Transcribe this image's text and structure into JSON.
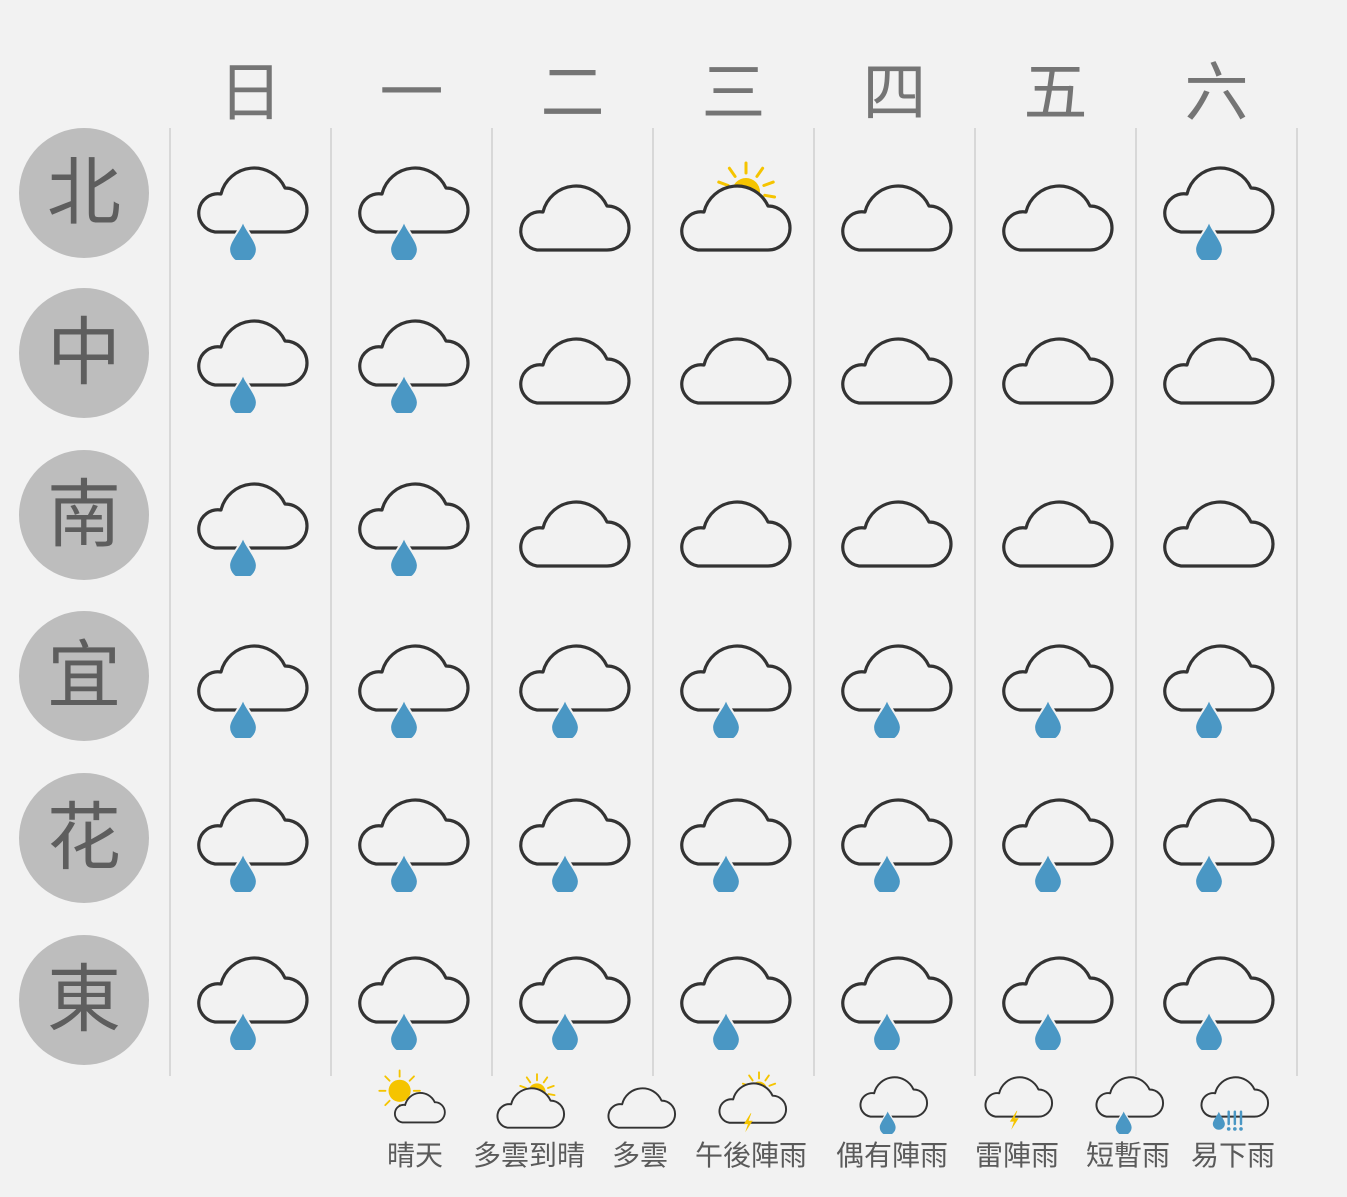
{
  "days": [
    "日",
    "一",
    "二",
    "三",
    "四",
    "五",
    "六"
  ],
  "regions": [
    "北",
    "中",
    "南",
    "宜",
    "花",
    "東"
  ],
  "forecast": [
    [
      "occasional_shower",
      "occasional_shower",
      "cloudy",
      "cloudy_to_sunny",
      "cloudy",
      "cloudy",
      "occasional_shower"
    ],
    [
      "occasional_shower",
      "occasional_shower",
      "cloudy",
      "cloudy",
      "cloudy",
      "cloudy",
      "cloudy"
    ],
    [
      "occasional_shower",
      "occasional_shower",
      "cloudy",
      "cloudy",
      "cloudy",
      "cloudy",
      "cloudy"
    ],
    [
      "occasional_shower",
      "occasional_shower",
      "occasional_shower",
      "occasional_shower",
      "occasional_shower",
      "occasional_shower",
      "occasional_shower"
    ],
    [
      "occasional_shower",
      "occasional_shower",
      "occasional_shower",
      "occasional_shower",
      "occasional_shower",
      "occasional_shower",
      "occasional_shower"
    ],
    [
      "occasional_shower",
      "occasional_shower",
      "occasional_shower",
      "occasional_shower",
      "occasional_shower",
      "occasional_shower",
      "occasional_shower"
    ]
  ],
  "legend": [
    {
      "key": "sunny",
      "label": "晴天"
    },
    {
      "key": "cloudy_to_sunny",
      "label": "多雲到晴"
    },
    {
      "key": "cloudy",
      "label": "多雲"
    },
    {
      "key": "afternoon_thunder",
      "label": "午後陣雨"
    },
    {
      "key": "occasional_shower",
      "label": "偶有陣雨"
    },
    {
      "key": "thunderstorm",
      "label": "雷陣雨"
    },
    {
      "key": "brief_rain",
      "label": "短暫雨"
    },
    {
      "key": "likely_rain",
      "label": "易下雨"
    }
  ],
  "colors": {
    "background": "#f2f2f2",
    "outline": "#333333",
    "rain": "#4a97c4",
    "sun": "#f5c400",
    "region_circle": "#bdbdbd",
    "grid_line": "#d8d8d8"
  }
}
